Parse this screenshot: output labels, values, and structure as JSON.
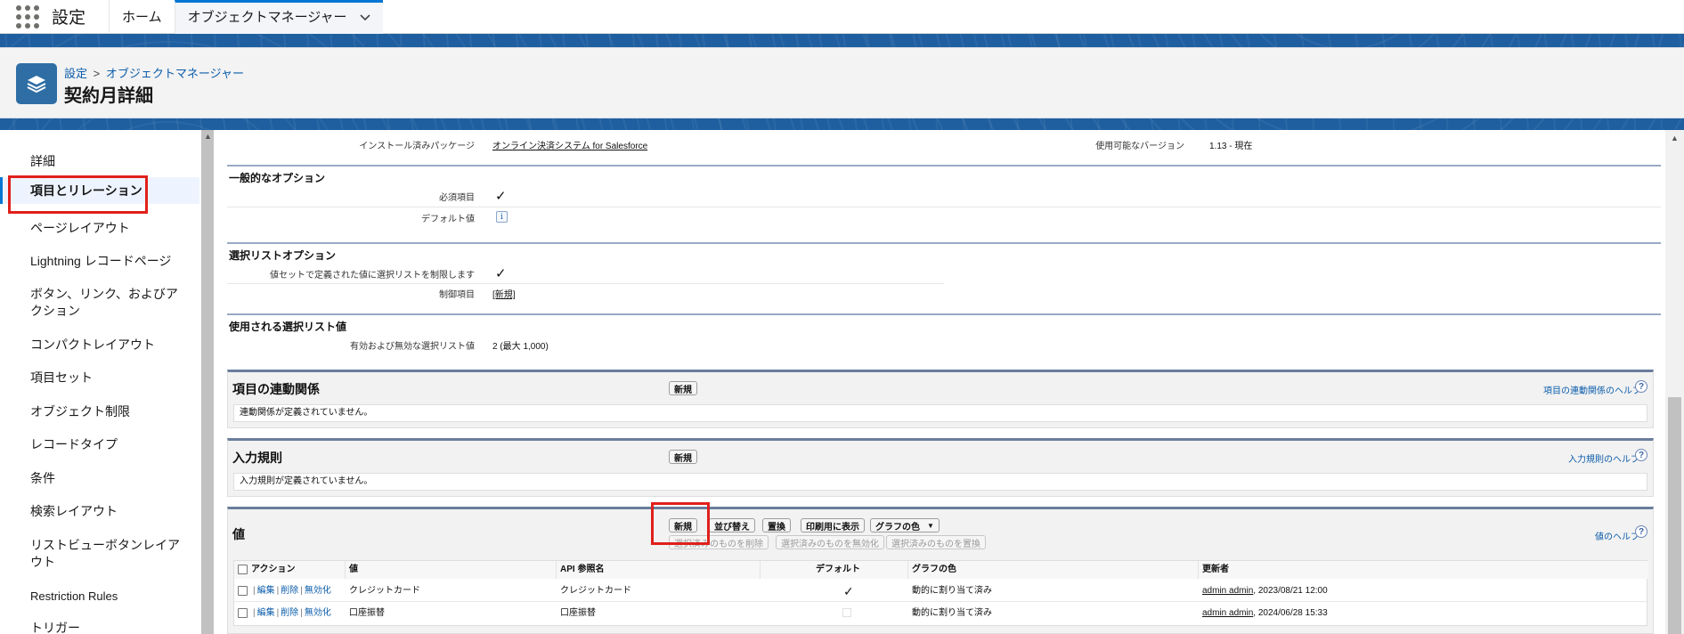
{
  "app": {
    "name": "設定"
  },
  "nav": {
    "tabs": [
      {
        "label": "ホーム"
      },
      {
        "label": "オブジェクトマネージャー"
      }
    ]
  },
  "header": {
    "breadcrumb": {
      "setup": "設定",
      "separator": ">",
      "object_manager": "オブジェクトマネージャー"
    },
    "title": "契約月詳細"
  },
  "sidebar": {
    "items": [
      {
        "label": "詳細"
      },
      {
        "label": "項目とリレーション"
      },
      {
        "label": "ページレイアウト"
      },
      {
        "label": "Lightning レコードページ"
      },
      {
        "label": "ボタン、リンク、およびア"
      },
      {
        "label": "クション"
      },
      {
        "label": "コンパクトレイアウト"
      },
      {
        "label": "項目セット"
      },
      {
        "label": "オブジェクト制限"
      },
      {
        "label": "レコードタイプ"
      },
      {
        "label": "条件"
      },
      {
        "label": "検索レイアウト"
      },
      {
        "label": "リストビューボタンレイア"
      },
      {
        "label": "ウト"
      },
      {
        "label": "Restriction Rules"
      },
      {
        "label": "トリガー"
      }
    ]
  },
  "detail": {
    "installed_package_label": "インストール済みパッケージ",
    "installed_package_value": "オンライン決済システム for Salesforce",
    "available_version_label": "使用可能なバージョン",
    "available_version_value": "1.13 - 現在",
    "general_options_title": "一般的なオプション",
    "required_label": "必須項目",
    "required_check": "✓",
    "default_value_label": "デフォルト値",
    "info_icon_text": "i",
    "picklist_options_title": "選択リストオプション",
    "restrict_label": "値セットで定義された値に選択リストを制限します",
    "restrict_check": "✓",
    "controlling_field_label": "制御項目",
    "controlling_field_value": "[新規]",
    "picklist_values_title": "使用される選択リスト値",
    "active_inactive_label": "有効および無効な選択リスト値",
    "active_inactive_value": "2 (最大 1,000)"
  },
  "dependencies": {
    "title": "項目の連動関係",
    "new_button": "新規",
    "help_link": "項目の連動関係のヘルプ",
    "help_q": "?",
    "empty_text": "連動関係が定義されていません。"
  },
  "validation": {
    "title": "入力規則",
    "new_button": "新規",
    "help_link": "入力規則のヘルプ",
    "help_q": "?",
    "empty_text": "入力規則が定義されていません。"
  },
  "values": {
    "title": "値",
    "help_link": "値のヘルプ",
    "help_q": "?",
    "buttons": {
      "new": "新規",
      "reorder": "並び替え",
      "replace": "置換",
      "print": "印刷用に表示",
      "chart_colors": "グラフの色",
      "chart_colors_caret": "▼"
    },
    "mass_buttons": {
      "delete": "選択済みのものを削除",
      "deactivate": "選択済みのものを無効化",
      "replace": "選択済みのものを置換"
    },
    "columns": {
      "action": "アクション",
      "value": "値",
      "api_name": "API 参照名",
      "default": "デフォルト",
      "chart_color": "グラフの色",
      "modified_by": "更新者"
    },
    "row_actions": {
      "edit": "編集",
      "delete": "削除",
      "deactivate": "無効化",
      "separator": "|"
    },
    "rows": [
      {
        "value": "クレジットカード",
        "api_name": "クレジットカード",
        "default_mark": "✓",
        "chart_color": "動的に割り当て済み",
        "modified_user": "admin admin",
        "modified_date": ", 2023/08/21 12:00"
      },
      {
        "value": "口座振替",
        "api_name": "口座振替",
        "default_mark": "",
        "chart_color": "動的に割り当て済み",
        "modified_user": "admin admin",
        "modified_date": ", 2024/06/28 15:33"
      }
    ]
  }
}
